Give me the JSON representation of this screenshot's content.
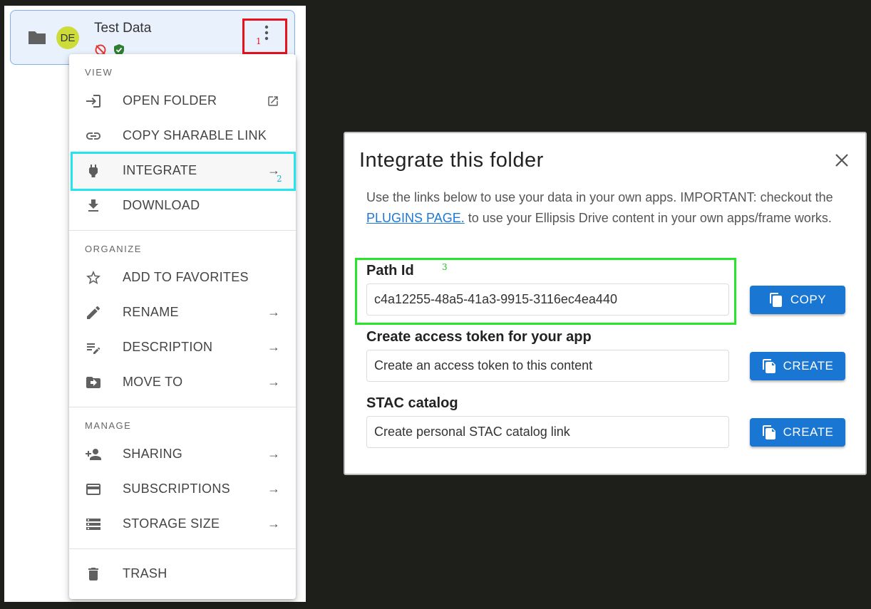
{
  "folder": {
    "title": "Test Data",
    "avatar_initials": "DE",
    "avatar_color": "#cddc39",
    "status_icons": [
      "no-location-icon",
      "verified-shield-icon"
    ]
  },
  "annotations": {
    "marker_1": "1",
    "marker_2": "2",
    "marker_3": "3"
  },
  "menu": {
    "sections": {
      "view": "VIEW",
      "organize": "ORGANIZE",
      "manage": "MANAGE"
    },
    "items": {
      "open_folder": "OPEN FOLDER",
      "copy_link": "COPY SHARABLE LINK",
      "integrate": "INTEGRATE",
      "download": "DOWNLOAD",
      "add_favorites": "ADD TO FAVORITES",
      "rename": "RENAME",
      "description": "DESCRIPTION",
      "move_to": "MOVE TO",
      "sharing": "SHARING",
      "subscriptions": "SUBSCRIPTIONS",
      "storage_size": "STORAGE SIZE",
      "trash": "TRASH"
    },
    "arrow": "→"
  },
  "dialog": {
    "title": "Integrate this folder",
    "desc_part1": "Use the links below to use your data in your own apps. IMPORTANT: checkout the ",
    "desc_link": "PLUGINS PAGE.",
    "desc_part2": " to use your Ellipsis Drive content in your own apps/frame works.",
    "path_label": "Path Id",
    "path_value": "c4a12255-48a5-41a3-9915-3116ec4ea440",
    "copy_label": "COPY",
    "token_label": "Create access token for your app",
    "token_placeholder": "Create an access token to this content",
    "stac_label": "STAC catalog",
    "stac_placeholder": "Create personal STAC catalog link",
    "create_label": "CREATE"
  },
  "colors": {
    "primary": "#1976d2",
    "highlight_red": "#e8121d",
    "highlight_cyan": "#22e5f0",
    "highlight_green": "#25e62a"
  }
}
